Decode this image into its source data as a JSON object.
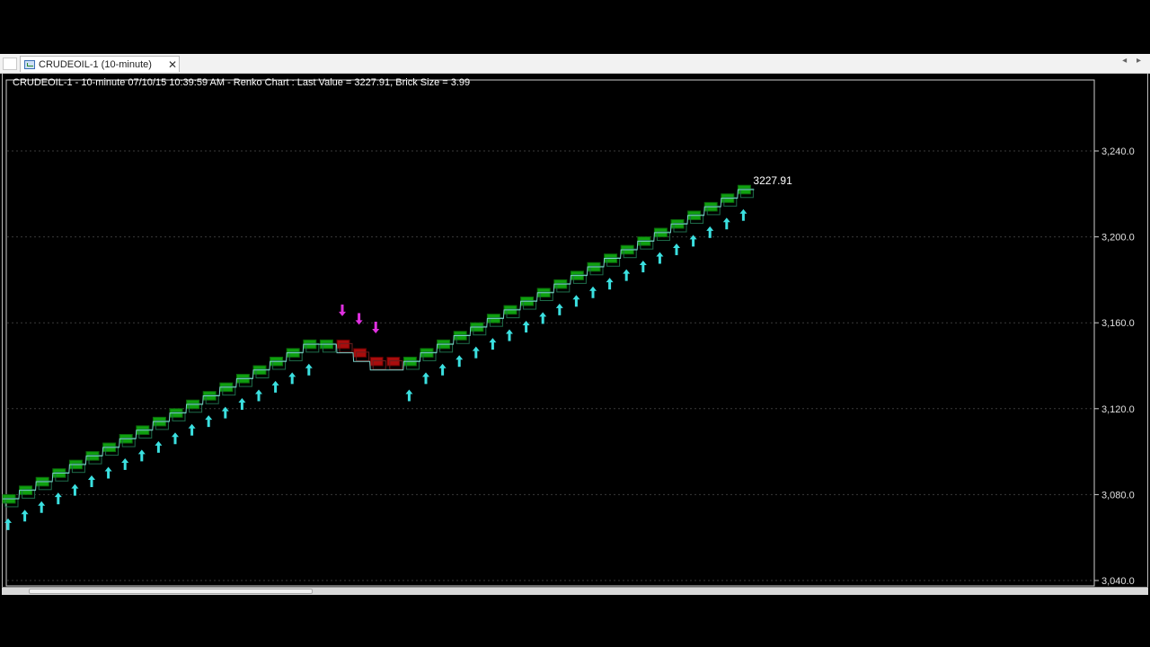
{
  "tab": {
    "label": "CRUDEOIL-1 (10-minute)",
    "close_label": "✕"
  },
  "nav": {
    "arrows": "◂ ▸"
  },
  "chart_title": "CRUDEOIL-1 - 10-minute 07/10/15 10:39:59 AM - Renko Chart : Last Value = 3227.91, Brick Size = 3.99",
  "chart_data": {
    "type": "renko",
    "title": "CRUDEOIL-1 - 10-minute 07/10/15 10:39:59 AM - Renko Chart : Last Value = 3227.91, Brick Size = 3.99",
    "symbol": "CRUDEOIL-1",
    "interval": "10-minute",
    "last_value": 3227.91,
    "last_value_label": "3227.91",
    "brick_size": 3.99,
    "ylim": [
      3040,
      3280
    ],
    "y_ticks": [
      3040,
      3080,
      3120,
      3160,
      3200,
      3240
    ],
    "y_tick_labels": [
      "3,040.0",
      "3,080.0",
      "3,120.0",
      "3,160.0",
      "3,200.0",
      "3,240.0"
    ],
    "grid": true,
    "colors": {
      "up": "#0fa00f",
      "down": "#a80d0d",
      "buy_marker": "#3be0e0",
      "sell_marker": "#e030e0",
      "background": "#000000"
    },
    "bricks": [
      {
        "dir": "up",
        "close": 3080
      },
      {
        "dir": "up",
        "close": 3084
      },
      {
        "dir": "up",
        "close": 3088
      },
      {
        "dir": "up",
        "close": 3092
      },
      {
        "dir": "up",
        "close": 3096
      },
      {
        "dir": "up",
        "close": 3100
      },
      {
        "dir": "up",
        "close": 3104
      },
      {
        "dir": "up",
        "close": 3108
      },
      {
        "dir": "up",
        "close": 3112
      },
      {
        "dir": "up",
        "close": 3116
      },
      {
        "dir": "up",
        "close": 3120
      },
      {
        "dir": "up",
        "close": 3124
      },
      {
        "dir": "up",
        "close": 3128
      },
      {
        "dir": "up",
        "close": 3132
      },
      {
        "dir": "up",
        "close": 3136
      },
      {
        "dir": "up",
        "close": 3140
      },
      {
        "dir": "up",
        "close": 3144
      },
      {
        "dir": "up",
        "close": 3148
      },
      {
        "dir": "up",
        "close": 3152
      },
      {
        "dir": "up",
        "close": 3152
      },
      {
        "dir": "down",
        "close": 3148
      },
      {
        "dir": "down",
        "close": 3144
      },
      {
        "dir": "down",
        "close": 3140
      },
      {
        "dir": "down",
        "close": 3140
      },
      {
        "dir": "up",
        "close": 3144
      },
      {
        "dir": "up",
        "close": 3148
      },
      {
        "dir": "up",
        "close": 3152
      },
      {
        "dir": "up",
        "close": 3156
      },
      {
        "dir": "up",
        "close": 3160
      },
      {
        "dir": "up",
        "close": 3164
      },
      {
        "dir": "up",
        "close": 3168
      },
      {
        "dir": "up",
        "close": 3172
      },
      {
        "dir": "up",
        "close": 3176
      },
      {
        "dir": "up",
        "close": 3180
      },
      {
        "dir": "up",
        "close": 3184
      },
      {
        "dir": "up",
        "close": 3188
      },
      {
        "dir": "up",
        "close": 3192
      },
      {
        "dir": "up",
        "close": 3196
      },
      {
        "dir": "up",
        "close": 3200
      },
      {
        "dir": "up",
        "close": 3204
      },
      {
        "dir": "up",
        "close": 3208
      },
      {
        "dir": "up",
        "close": 3212
      },
      {
        "dir": "up",
        "close": 3216
      },
      {
        "dir": "up",
        "close": 3220
      },
      {
        "dir": "up",
        "close": 3224
      }
    ],
    "markers": [
      {
        "index": 0,
        "type": "buy",
        "value": 3066
      },
      {
        "index": 1,
        "type": "buy",
        "value": 3070
      },
      {
        "index": 2,
        "type": "buy",
        "value": 3074
      },
      {
        "index": 3,
        "type": "buy",
        "value": 3078
      },
      {
        "index": 4,
        "type": "buy",
        "value": 3082
      },
      {
        "index": 5,
        "type": "buy",
        "value": 3086
      },
      {
        "index": 6,
        "type": "buy",
        "value": 3090
      },
      {
        "index": 7,
        "type": "buy",
        "value": 3094
      },
      {
        "index": 8,
        "type": "buy",
        "value": 3098
      },
      {
        "index": 9,
        "type": "buy",
        "value": 3102
      },
      {
        "index": 10,
        "type": "buy",
        "value": 3106
      },
      {
        "index": 11,
        "type": "buy",
        "value": 3110
      },
      {
        "index": 12,
        "type": "buy",
        "value": 3114
      },
      {
        "index": 13,
        "type": "buy",
        "value": 3118
      },
      {
        "index": 14,
        "type": "buy",
        "value": 3122
      },
      {
        "index": 15,
        "type": "buy",
        "value": 3126
      },
      {
        "index": 16,
        "type": "buy",
        "value": 3130
      },
      {
        "index": 17,
        "type": "buy",
        "value": 3134
      },
      {
        "index": 18,
        "type": "buy",
        "value": 3138
      },
      {
        "index": 20,
        "type": "sell",
        "value": 3166
      },
      {
        "index": 21,
        "type": "sell",
        "value": 3162
      },
      {
        "index": 22,
        "type": "sell",
        "value": 3158
      },
      {
        "index": 24,
        "type": "buy",
        "value": 3126
      },
      {
        "index": 25,
        "type": "buy",
        "value": 3134
      },
      {
        "index": 26,
        "type": "buy",
        "value": 3138
      },
      {
        "index": 27,
        "type": "buy",
        "value": 3142
      },
      {
        "index": 28,
        "type": "buy",
        "value": 3146
      },
      {
        "index": 29,
        "type": "buy",
        "value": 3150
      },
      {
        "index": 30,
        "type": "buy",
        "value": 3154
      },
      {
        "index": 31,
        "type": "buy",
        "value": 3158
      },
      {
        "index": 32,
        "type": "buy",
        "value": 3162
      },
      {
        "index": 33,
        "type": "buy",
        "value": 3166
      },
      {
        "index": 34,
        "type": "buy",
        "value": 3170
      },
      {
        "index": 35,
        "type": "buy",
        "value": 3174
      },
      {
        "index": 36,
        "type": "buy",
        "value": 3178
      },
      {
        "index": 37,
        "type": "buy",
        "value": 3182
      },
      {
        "index": 38,
        "type": "buy",
        "value": 3186
      },
      {
        "index": 39,
        "type": "buy",
        "value": 3190
      },
      {
        "index": 40,
        "type": "buy",
        "value": 3194
      },
      {
        "index": 41,
        "type": "buy",
        "value": 3198
      },
      {
        "index": 42,
        "type": "buy",
        "value": 3202
      },
      {
        "index": 43,
        "type": "buy",
        "value": 3206
      },
      {
        "index": 44,
        "type": "buy",
        "value": 3210
      }
    ]
  }
}
